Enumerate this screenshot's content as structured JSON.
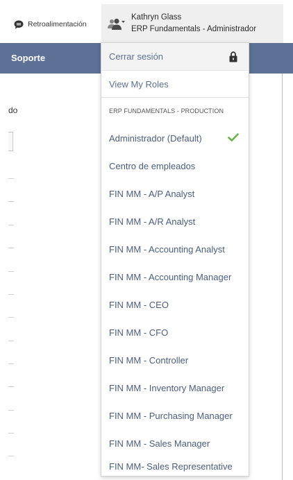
{
  "header": {
    "feedback_label": "Retroalimentación",
    "user_name": "Kathryn Glass",
    "user_role": "ERP Fundamentals - Administrador"
  },
  "nav": {
    "label": "Soporte"
  },
  "background": {
    "fragment_text": "do"
  },
  "menu": {
    "logout_label": "Cerrar sesión",
    "view_roles_label": "View My Roles",
    "section_label": "ERP FUNDAMENTALS - PRODUCTION",
    "roles": [
      "Administrador (Default)",
      "Centro de empleados",
      "FIN MM - A/P Analyst",
      "FIN MM - A/R Analyst",
      "FIN MM - Accounting Analyst",
      "FIN MM - Accounting Manager",
      "FIN MM - CEO",
      "FIN MM - CFO",
      "FIN MM - Controller",
      "FIN MM - Inventory Manager",
      "FIN MM - Purchasing Manager",
      "FIN MM - Sales Manager",
      "FIN MM- Sales Representative"
    ],
    "active_role_index": 0
  },
  "colors": {
    "nav_bar": "#5d7196",
    "menu_text": "#4a5d80",
    "check": "#6ab04c"
  },
  "icons": {
    "feedback": "chat-bubble-icon",
    "user": "users-icon",
    "logout": "lock-icon",
    "active_role": "checkmark-icon"
  }
}
